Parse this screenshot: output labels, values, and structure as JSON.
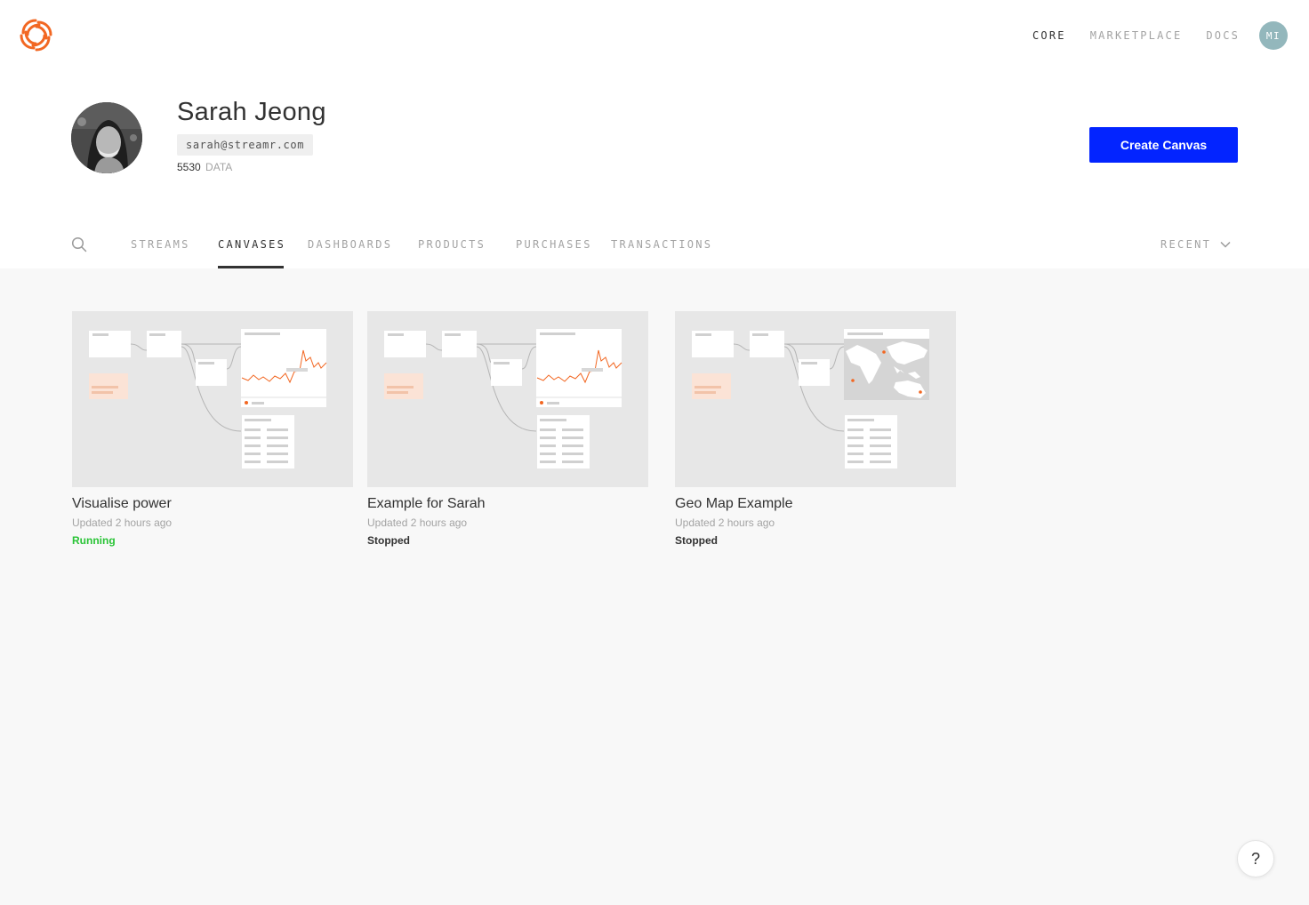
{
  "nav": {
    "links": [
      {
        "label": "CORE",
        "active": true
      },
      {
        "label": "MARKETPLACE",
        "active": false
      },
      {
        "label": "DOCS",
        "active": false
      }
    ],
    "avatar_initials": "MI"
  },
  "profile": {
    "name": "Sarah Jeong",
    "email": "sarah@streamr.com",
    "balance": "5530",
    "balance_unit": "DATA"
  },
  "actions": {
    "create_label": "Create Canvas"
  },
  "tabs": [
    {
      "label": "STREAMS",
      "active": false
    },
    {
      "label": "CANVASES",
      "active": true
    },
    {
      "label": "DASHBOARDS",
      "active": false
    },
    {
      "label": "PRODUCTS",
      "active": false
    },
    {
      "label": "PURCHASES",
      "active": false
    },
    {
      "label": "TRANSACTIONS",
      "active": false
    }
  ],
  "sort": {
    "label": "RECENT"
  },
  "canvases": [
    {
      "title": "Visualise power",
      "updated": "Updated 2 hours ago",
      "status": "Running",
      "preview": "chart"
    },
    {
      "title": "Example for Sarah",
      "updated": "Updated 2 hours ago",
      "status": "Stopped",
      "preview": "chart"
    },
    {
      "title": "Geo Map Example",
      "updated": "Updated 2 hours ago",
      "status": "Stopped",
      "preview": "map"
    }
  ],
  "help": {
    "label": "?"
  },
  "colors": {
    "brand_orange": "#f26722",
    "primary_blue": "#0324ff",
    "running_green": "#2ac437",
    "avatar_teal": "#93b7bc"
  }
}
